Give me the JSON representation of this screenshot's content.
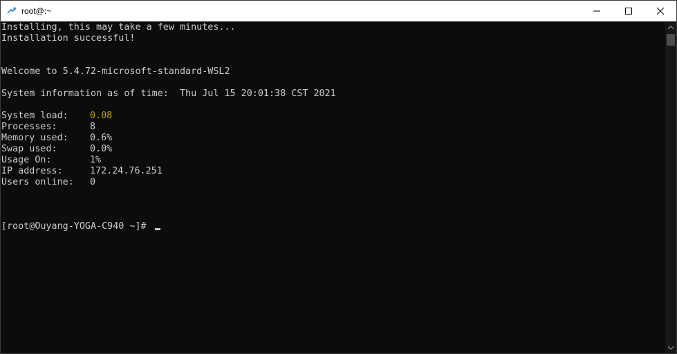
{
  "window": {
    "title": "root@:~",
    "controls": {
      "minimize_icon": "minimize-icon",
      "maximize_icon": "maximize-icon",
      "close_icon": "close-icon"
    },
    "app_icon": "linux-penguin-icon"
  },
  "terminal": {
    "install_line_1": "Installing, this may take a few minutes...",
    "install_line_2": "Installation successful!",
    "welcome": "Welcome to 5.4.72-microsoft-standard-WSL2",
    "sysinfo_header": "System information as of time:  Thu Jul 15 20:01:38 CST 2021",
    "stats": [
      {
        "label": "System load:",
        "value": "0.08",
        "color": "#c19c00"
      },
      {
        "label": "Processes:",
        "value": "8"
      },
      {
        "label": "Memory used:",
        "value": "0.6%"
      },
      {
        "label": "Swap used:",
        "value": "0.0%"
      },
      {
        "label": "Usage On:",
        "value": "1%"
      },
      {
        "label": "IP address:",
        "value": "172.24.76.251"
      },
      {
        "label": "Users online:",
        "value": "0"
      }
    ],
    "prompt": "[root@Ouyang-YOGA-C940 ~]# "
  },
  "colors": {
    "background": "#0c0c0c",
    "foreground": "#cccccc",
    "highlight": "#c19c00"
  }
}
